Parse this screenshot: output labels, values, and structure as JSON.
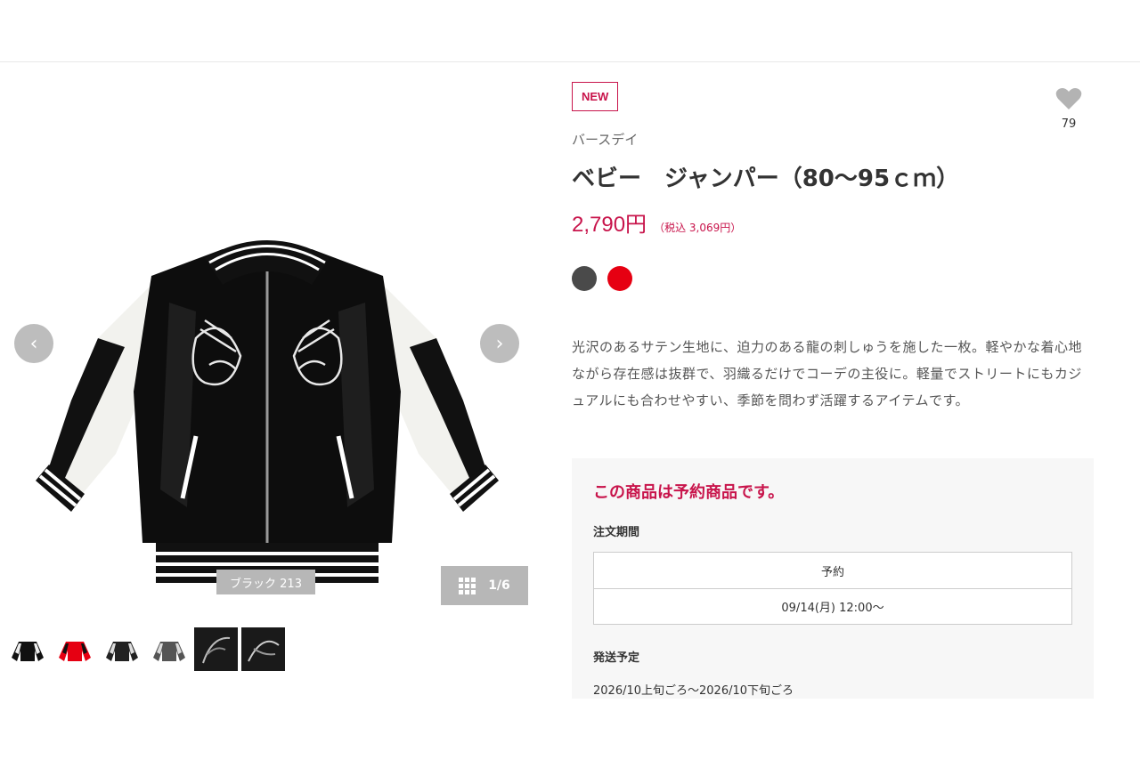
{
  "gallery": {
    "prev_icon": "chevron-left-icon",
    "next_icon": "chevron-right-icon",
    "color_caption": "ブラック 213",
    "page_indicator": "1/6",
    "grid_icon": "grid-icon",
    "thumbnails": [
      "black-jacket",
      "red-jacket",
      "black-jacket-2",
      "grey-jacket",
      "detail-dark-1",
      "detail-dark-2"
    ]
  },
  "product": {
    "badge": "NEW",
    "favorite_icon": "heart-icon",
    "favorite_count": "79",
    "brand": "バースデイ",
    "title": "ベビー　ジャンパー（80～95ｃｍ）",
    "price": "2,790円",
    "price_tax": "（税込 3,069円）",
    "colors": [
      {
        "name": "dark-grey",
        "hex": "#4a4a4a"
      },
      {
        "name": "red",
        "hex": "#e60012"
      }
    ],
    "description": "光沢のあるサテン生地に、迫力のある龍の刺しゅうを施した一枚。軽やかな着心地ながら存在感は抜群で、羽織るだけでコーデの主役に。軽量でストリートにもカジュアルにも合わせやすい、季節を問わず活躍するアイテムです。"
  },
  "preorder": {
    "title": "この商品は予約商品です。",
    "order_period_label": "注文期間",
    "order_type": "予約",
    "order_start": "09/14(月) 12:00～",
    "shipping_label": "発送予定",
    "shipping_value": "2026/10上旬ごろ～2026/10下旬ごろ"
  },
  "colors": {
    "accent": "#c8144b",
    "gray_overlay": "#b7b7b7"
  }
}
